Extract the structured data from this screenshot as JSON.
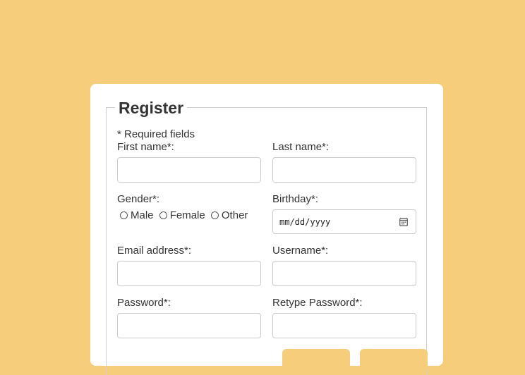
{
  "form": {
    "title": "Register",
    "required_note": "* Required fields",
    "first_name_label": "First name*:",
    "last_name_label": "Last name*:",
    "gender_label": "Gender*:",
    "gender_options": [
      "Male",
      "Female",
      "Other"
    ],
    "birthday_label": "Birthday*:",
    "birthday_placeholder": "mm/dd/yyyy",
    "email_label": "Email address*:",
    "username_label": "Username*:",
    "password_label": "Password*:",
    "retype_password_label": "Retype Password*:",
    "first_name_value": "",
    "last_name_value": "",
    "email_value": "",
    "username_value": "",
    "password_value": "",
    "retype_password_value": ""
  },
  "icons": {
    "calendar": "calendar-icon",
    "radio": "radio-unchecked-icon"
  },
  "colors": {
    "background": "#f6cd7b",
    "card": "#ffffff",
    "text": "#333333",
    "input_border": "#cccccc"
  }
}
